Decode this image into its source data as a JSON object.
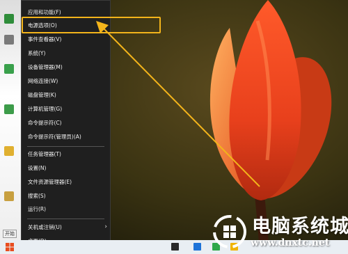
{
  "menu": {
    "items": [
      {
        "label": "应用和功能(F)"
      },
      {
        "label": "电源选项(O)"
      },
      {
        "label": "事件查看器(V)"
      },
      {
        "label": "系统(Y)"
      },
      {
        "label": "设备管理器(M)"
      },
      {
        "label": "网络连接(W)"
      },
      {
        "label": "磁盘管理(K)"
      },
      {
        "label": "计算机管理(G)"
      },
      {
        "label": "命令提示符(C)"
      },
      {
        "label": "命令提示符(管理员)(A)"
      },
      {
        "label": "任务管理器(T)"
      },
      {
        "label": "设置(N)"
      },
      {
        "label": "文件资源管理器(E)"
      },
      {
        "label": "搜索(S)"
      },
      {
        "label": "运行(R)"
      },
      {
        "label": "关机或注销(U)"
      },
      {
        "label": "桌面(D)"
      }
    ],
    "submenu_arrow": "›"
  },
  "taskbar": {
    "start_tooltip": "开始"
  },
  "watermark": {
    "brand": "电脑系统城",
    "url": "www.dnxtc.net"
  },
  "colors": {
    "highlight": "#f3b41b",
    "menu_bg": "#1f1f1f",
    "menu_text": "#f2f2f2"
  }
}
